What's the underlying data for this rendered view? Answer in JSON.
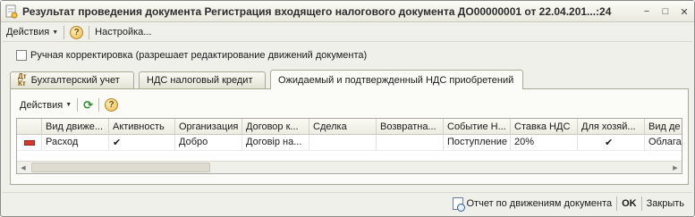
{
  "window": {
    "title": "Результат проведения документа Регистрация входящего налогового документа ДО00000001 от 22.04.201...:24",
    "controls": [
      "−",
      "□",
      "✕"
    ]
  },
  "toolbar": {
    "actions_label": "Действия",
    "settings_label": "Настройка..."
  },
  "manual_correction": {
    "label": "Ручная корректировка (разрешает редактирование движений документа)",
    "checked": false
  },
  "tabs": [
    {
      "label": "Бухгалтерский учет",
      "icon_text": "Дт\nКт"
    },
    {
      "label": "НДС налоговый кредит"
    },
    {
      "label": "Ожидаемый и подтвержденный НДС приобретений",
      "active": true
    }
  ],
  "panel_toolbar": {
    "actions_label": "Действия"
  },
  "grid": {
    "columns": [
      "",
      "Вид движе...",
      "Активность",
      "Организация",
      "Договор к...",
      "Сделка",
      "Возвратна...",
      "Событие Н...",
      "Ставка НДС",
      "Для хозяй...",
      "Вид де"
    ],
    "rows": [
      [
        "",
        "Расход",
        "✔",
        "Добро",
        "Договір на...",
        "",
        "",
        "Поступление",
        "20%",
        "✔",
        "Облага"
      ]
    ]
  },
  "bottom": {
    "report_label": "Отчет по движениям документа",
    "ok_label": "OK",
    "close_label": "Закрыть"
  },
  "colors": {
    "accent": "#e6b63a",
    "refresh": "#2e8b2e",
    "row_marker": "#d23a2e"
  }
}
